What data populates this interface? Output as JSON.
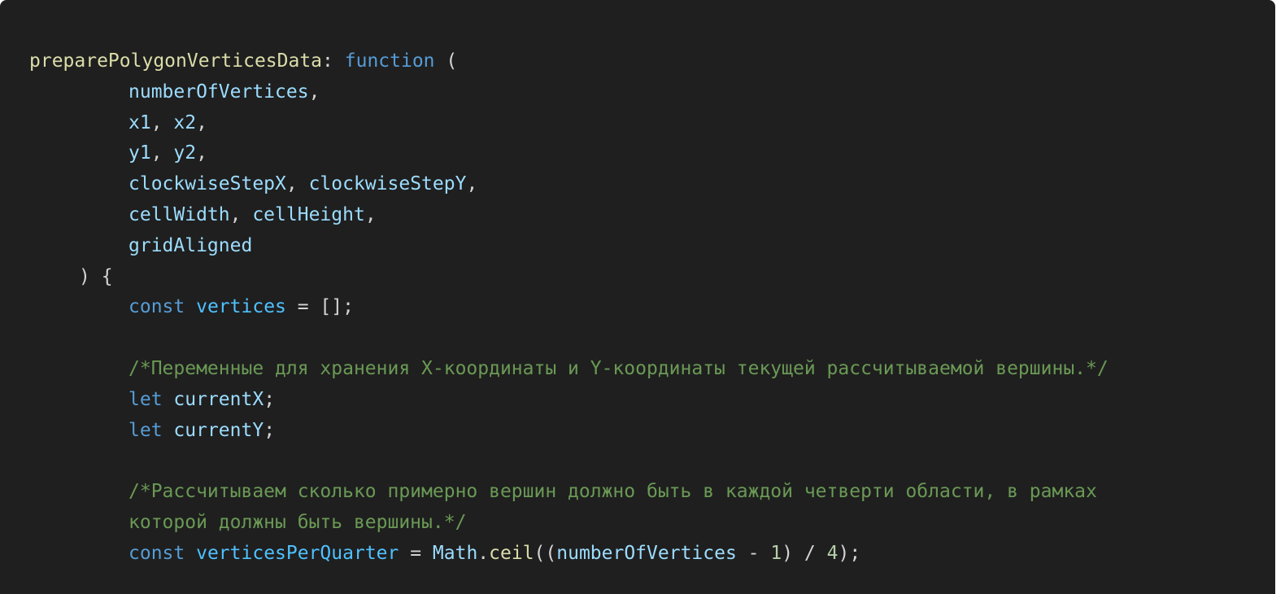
{
  "code": {
    "l1": {
      "name": "preparePolygonVerticesData",
      "colon": ":",
      "kw": "function",
      "paren": " ("
    },
    "l2": {
      "a": "numberOfVertices",
      "p": ","
    },
    "l3": {
      "a": "x1",
      "p1": ", ",
      "b": "x2",
      "p2": ","
    },
    "l4": {
      "a": "y1",
      "p1": ", ",
      "b": "y2",
      "p2": ","
    },
    "l5": {
      "a": "clockwiseStepX",
      "p1": ", ",
      "b": "clockwiseStepY",
      "p2": ","
    },
    "l6": {
      "a": "cellWidth",
      "p1": ", ",
      "b": "cellHeight",
      "p2": ","
    },
    "l7": {
      "a": "gridAligned"
    },
    "l8": {
      "p": ") {"
    },
    "l9": {
      "kw": "const",
      "v": "vertices",
      "rest": " = [];"
    },
    "l11": {
      "comment": "/*Переменные для хранения X-координаты и Y-координаты текущей рассчитываемой вершины.*/"
    },
    "l12": {
      "kw": "let",
      "v": "currentX",
      "p": ";"
    },
    "l13": {
      "kw": "let",
      "v": "currentY",
      "p": ";"
    },
    "l15": {
      "comment": "/*Рассчитываем сколько примерно вершин должно быть в каждой четверти области, в рамках"
    },
    "l16": {
      "comment": "которой должны быть вершины.*/"
    },
    "l17": {
      "kw": "const",
      "v": "verticesPerQuarter",
      "eq": " = ",
      "obj": "Math",
      "dot": ".",
      "fn": "ceil",
      "open": "((",
      "arg": "numberOfVertices",
      "op": " - ",
      "n1": "1",
      "close1": ") / ",
      "n2": "4",
      "end": ");"
    }
  },
  "colors": {
    "background": "#1f1f1f",
    "function_name": "#dcdcaa",
    "keyword": "#569cd6",
    "parameter": "#9cdcfe",
    "constant": "#4fc1ff",
    "comment": "#6a9955",
    "number": "#b5cea8"
  }
}
